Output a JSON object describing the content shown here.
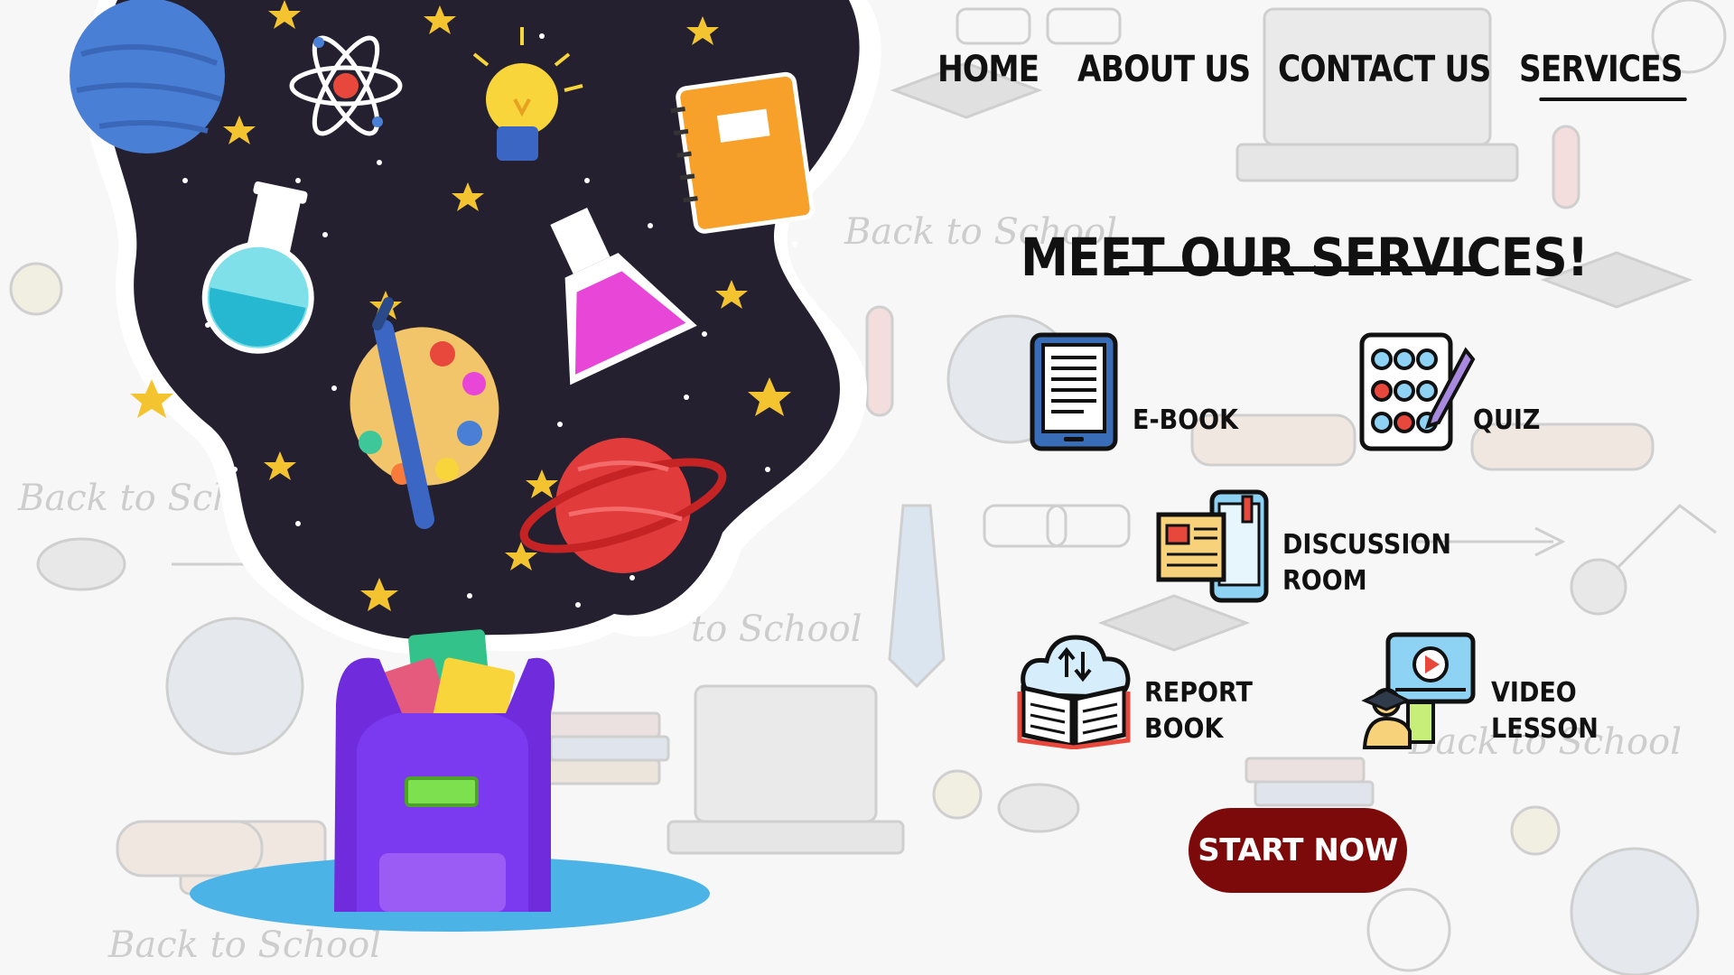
{
  "nav": {
    "items": [
      {
        "label": "HOME"
      },
      {
        "label": "ABOUT US"
      },
      {
        "label": "CONTACT US"
      },
      {
        "label": "SERVICES",
        "active": true
      }
    ]
  },
  "main": {
    "title": "MEET OUR SERVICES!",
    "services": [
      {
        "label": "E-BOOK",
        "icon": "ebook-reader-icon"
      },
      {
        "label": "QUIZ",
        "icon": "quiz-sheet-icon"
      },
      {
        "label_line1": "DISCUSSION",
        "label_line2": "ROOM",
        "icon": "discussion-room-icon"
      },
      {
        "label_line1": "REPORT",
        "label_line2": "BOOK",
        "icon": "report-book-icon"
      },
      {
        "label_line1": "VIDEO",
        "label_line2": "LESSON",
        "icon": "video-lesson-icon"
      }
    ],
    "cta": "START NOW"
  },
  "background_doodles": [
    "Back to School",
    "Back to School",
    "Back to School",
    "to School",
    "Back to School"
  ],
  "colors": {
    "cta_bg": "#7d0a0a",
    "space_bg": "#24202f",
    "planet_blue": "#4a7fd6",
    "planet_red": "#e23b3b",
    "backpack": "#6f2bdc"
  }
}
